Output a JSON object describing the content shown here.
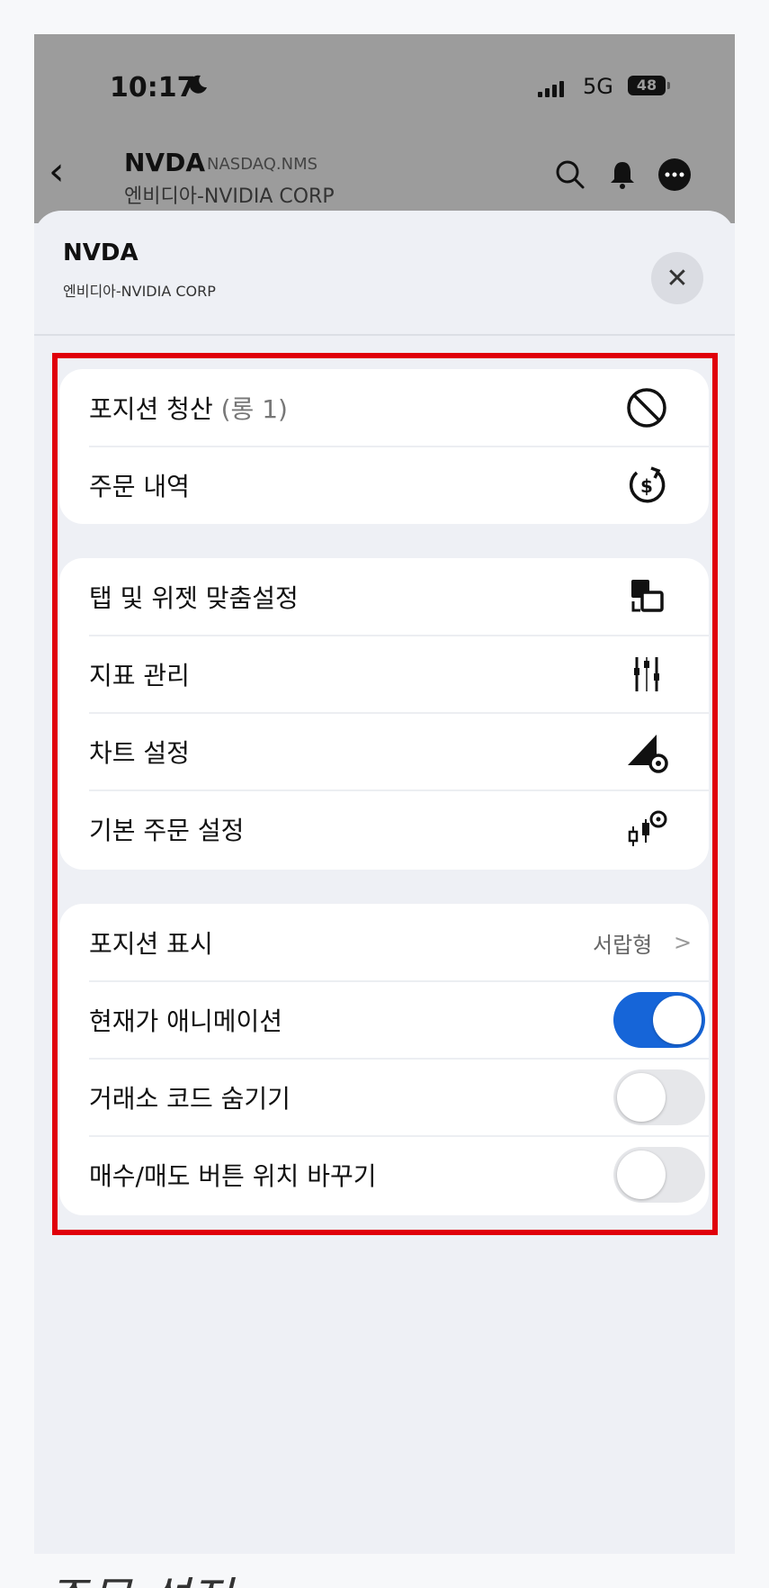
{
  "status_bar": {
    "time": "10:17",
    "network": "5G",
    "battery": "48"
  },
  "nav": {
    "ticker": "NVDA",
    "exchange": "NASDAQ.NMS",
    "company": "엔비디아-NVIDIA CORP"
  },
  "sheet": {
    "title": "NVDA",
    "subtitle": "엔비디아-NVIDIA CORP",
    "close_label": "✕"
  },
  "menu": {
    "group1": [
      {
        "label": "포지션 청산",
        "extra": "(롱 1)",
        "icon": "prohibit-icon"
      },
      {
        "label": "주문 내역",
        "extra": "",
        "icon": "dollar-history-icon"
      }
    ],
    "group2": [
      {
        "label": "탭 및 위젯 맞춤설정",
        "icon": "widget-swap-icon"
      },
      {
        "label": "지표 관리",
        "icon": "sliders-icon"
      },
      {
        "label": "차트 설정",
        "icon": "chart-gear-icon"
      },
      {
        "label": "기본 주문 설정",
        "icon": "candles-gear-icon"
      }
    ],
    "group3": {
      "position_display": {
        "label": "포지션 표시",
        "value": "서랍형",
        "chevron": ">"
      },
      "price_animation": {
        "label": "현재가 애니메이션",
        "on": true
      },
      "hide_exchange_code": {
        "label": "거래소 코드 숨기기",
        "on": false
      },
      "swap_buy_sell": {
        "label": "매수/매도 버튼 위치 바꾸기",
        "on": false
      }
    }
  },
  "caption": "주문 설정",
  "colors": {
    "highlight": "#e0000b",
    "toggle_on": "#1665d8"
  }
}
